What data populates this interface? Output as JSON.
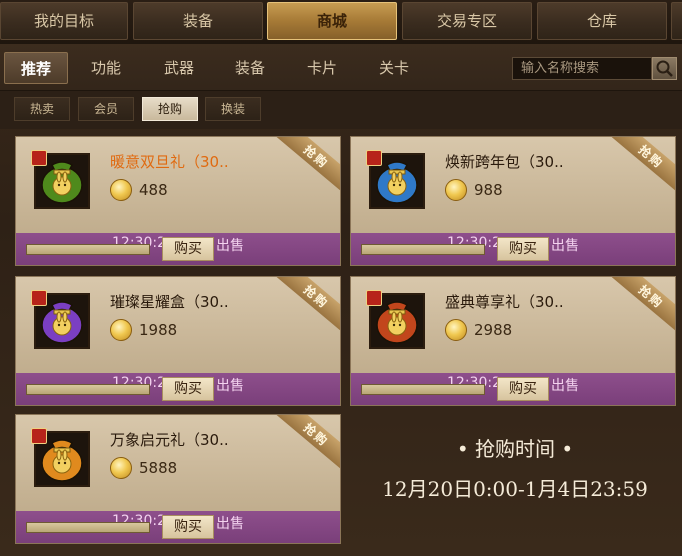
{
  "top_tabs": [
    {
      "label": "我的目标"
    },
    {
      "label": "装备"
    },
    {
      "label": "商城"
    },
    {
      "label": "交易专区"
    },
    {
      "label": "仓库"
    }
  ],
  "categories": [
    {
      "label": "推荐"
    },
    {
      "label": "功能"
    },
    {
      "label": "武器"
    },
    {
      "label": "装备"
    },
    {
      "label": "卡片"
    },
    {
      "label": "关卡"
    }
  ],
  "search": {
    "placeholder": "输入名称搜索",
    "icon": "search-icon"
  },
  "sub_tabs": [
    {
      "label": "热卖"
    },
    {
      "label": "会员"
    },
    {
      "label": "抢购"
    },
    {
      "label": "换装"
    }
  ],
  "products": [
    {
      "name": "暖意双旦礼（30..",
      "price": "488",
      "ribbon": "抢购",
      "timer": "12:30:2",
      "sale_text": "出售",
      "buy_label": "购买",
      "icon": "green-gift-bag-icon",
      "colors": {
        "bag": "#4f8a1c"
      }
    },
    {
      "name": "焕新跨年包（30..",
      "price": "988",
      "ribbon": "抢购",
      "timer": "12:30:2",
      "sale_text": "出售",
      "buy_label": "购买",
      "icon": "blue-gift-bag-icon",
      "colors": {
        "bag": "#2f79c8"
      }
    },
    {
      "name": "璀璨星耀盒（30..",
      "price": "1988",
      "ribbon": "抢购",
      "timer": "12:30:2",
      "sale_text": "出售",
      "buy_label": "购买",
      "icon": "purple-gift-bag-icon",
      "colors": {
        "bag": "#7b3fc2"
      }
    },
    {
      "name": "盛典尊享礼（30..",
      "price": "2988",
      "ribbon": "抢购",
      "timer": "12:30:2",
      "sale_text": "出售",
      "buy_label": "购买",
      "icon": "red-gift-bag-icon",
      "colors": {
        "bag": "#c2461c"
      }
    },
    {
      "name": "万象启元礼（30..",
      "price": "5888",
      "ribbon": "抢购",
      "timer": "12:30:2",
      "sale_text": "出售",
      "buy_label": "购买",
      "icon": "gold-gift-bag-icon",
      "colors": {
        "bag": "#e08a1e"
      }
    }
  ],
  "event": {
    "title": "• 抢购时间 •",
    "period": "12月20日0:00-1月4日23:59"
  }
}
